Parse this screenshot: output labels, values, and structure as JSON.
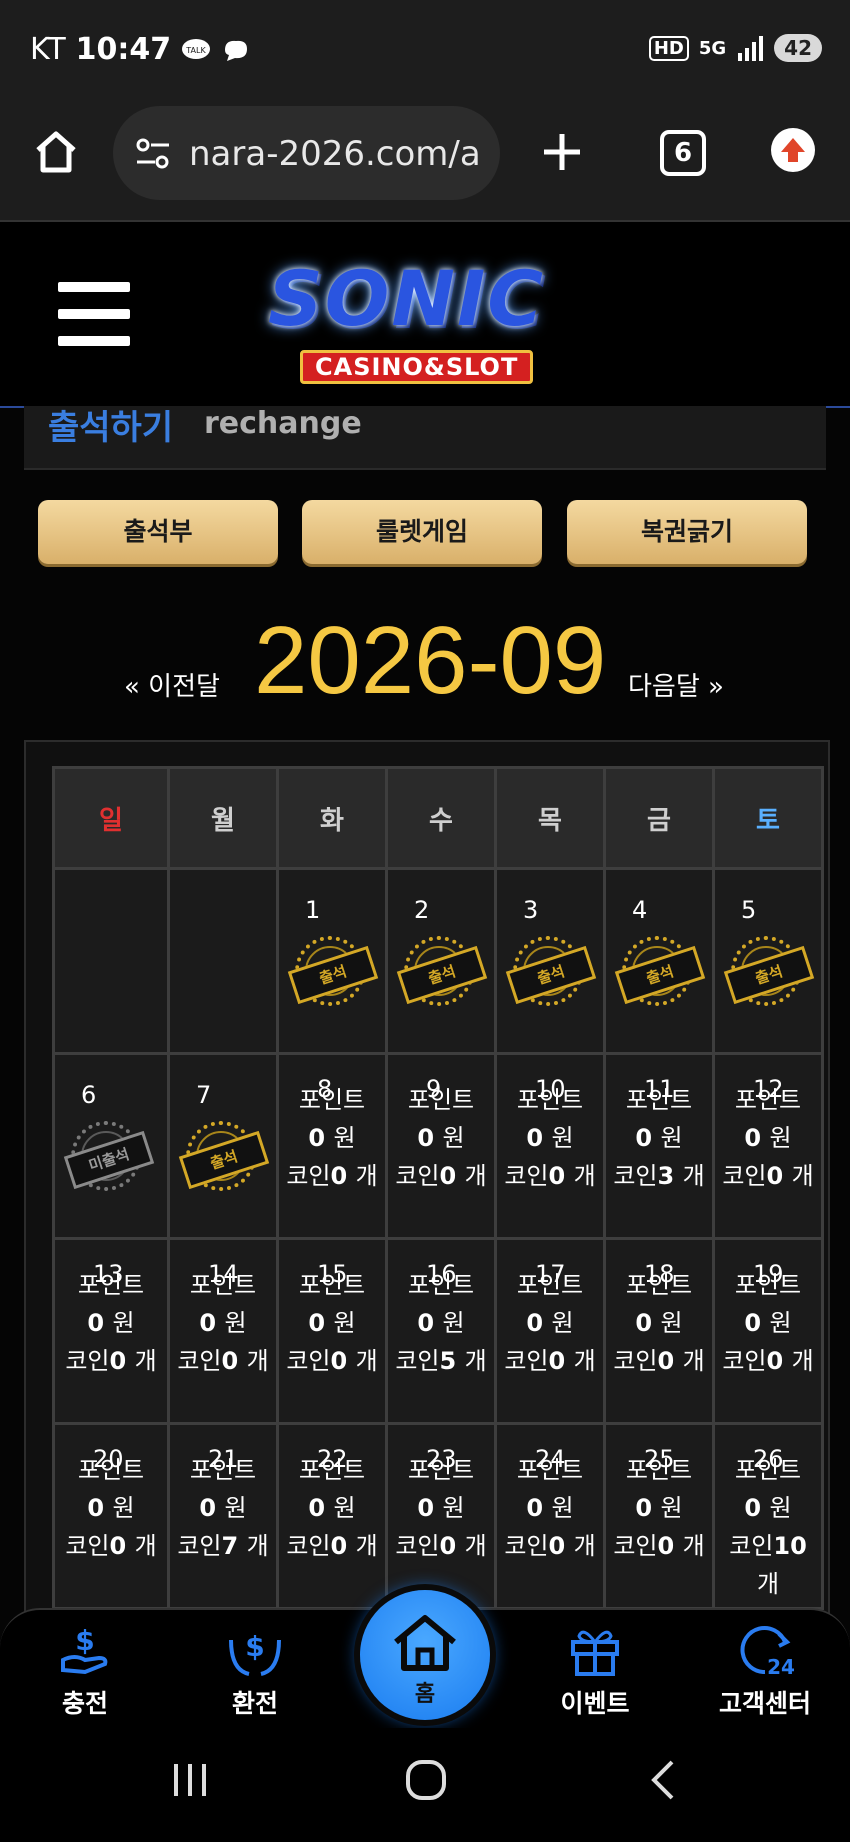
{
  "status_bar": {
    "carrier": "KT",
    "time": "10:47",
    "battery": "42",
    "network": "5G",
    "hd": "HD"
  },
  "browser": {
    "url": "nara-2026.com/a",
    "tab_count": "6"
  },
  "site": {
    "logo_main": "SONIC",
    "logo_sub": "CASINO&SLOT"
  },
  "section": {
    "title_ko": "출석하기",
    "title_en": "rechange"
  },
  "buttons": [
    "출석부",
    "룰렛게임",
    "복권긁기"
  ],
  "month_nav": {
    "prev": "« 이전달",
    "current": "2026-09",
    "next": "다음달 »"
  },
  "calendar": {
    "weekdays": [
      "일",
      "월",
      "화",
      "수",
      "목",
      "금",
      "토"
    ],
    "stamp_label": "출석",
    "missed_label": "미출석",
    "info_point_label": "포인트",
    "info_won": "원",
    "info_coin_label": "코인",
    "info_count": "개",
    "days": [
      {
        "day": "1",
        "status": "attended"
      },
      {
        "day": "2",
        "status": "attended"
      },
      {
        "day": "3",
        "status": "attended"
      },
      {
        "day": "4",
        "status": "attended"
      },
      {
        "day": "5",
        "status": "attended"
      },
      {
        "day": "6",
        "status": "missed"
      },
      {
        "day": "7",
        "status": "attended"
      },
      {
        "day": "8",
        "point": "0",
        "coin": "0"
      },
      {
        "day": "9",
        "point": "0",
        "coin": "0"
      },
      {
        "day": "10",
        "point": "0",
        "coin": "0"
      },
      {
        "day": "11",
        "point": "0",
        "coin": "3"
      },
      {
        "day": "12",
        "point": "0",
        "coin": "0"
      },
      {
        "day": "13",
        "point": "0",
        "coin": "0"
      },
      {
        "day": "14",
        "point": "0",
        "coin": "0"
      },
      {
        "day": "15",
        "point": "0",
        "coin": "0"
      },
      {
        "day": "16",
        "point": "0",
        "coin": "5"
      },
      {
        "day": "17",
        "point": "0",
        "coin": "0"
      },
      {
        "day": "18",
        "point": "0",
        "coin": "0"
      },
      {
        "day": "19",
        "point": "0",
        "coin": "0"
      },
      {
        "day": "20",
        "point": "0",
        "coin": "0"
      },
      {
        "day": "21",
        "point": "0",
        "coin": "7"
      },
      {
        "day": "22",
        "point": "0",
        "coin": "0"
      },
      {
        "day": "23",
        "point": "0",
        "coin": "0"
      },
      {
        "day": "24",
        "point": "0",
        "coin": "0"
      },
      {
        "day": "25",
        "point": "0",
        "coin": "0"
      },
      {
        "day": "26",
        "point": "0",
        "coin": "10"
      }
    ]
  },
  "bottom_nav": {
    "items": [
      {
        "label": "충전",
        "icon": "hand-dollar-icon"
      },
      {
        "label": "환전",
        "icon": "exchange-hands-icon"
      },
      {
        "label": "홈",
        "icon": "home-icon"
      },
      {
        "label": "이벤트",
        "icon": "gift-icon"
      },
      {
        "label": "고객센터",
        "icon": "support-24-icon"
      }
    ]
  },
  "colors": {
    "accent_blue": "#1a7cf0",
    "gold": "#f5c843",
    "sunday": "#e03030",
    "saturday": "#5ab0ff"
  }
}
